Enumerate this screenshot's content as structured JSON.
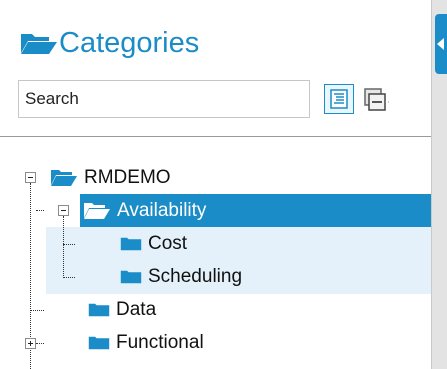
{
  "panel": {
    "title": "Categories",
    "title_icon": "folder-open-icon",
    "accent_color": "#1a8cc7"
  },
  "search": {
    "placeholder": "Search"
  },
  "toolbar": {
    "expand_all_icon": "expand-all-icon",
    "collapse_all_icon": "collapse-all-icon"
  },
  "tree": {
    "root": {
      "label": "RMDEMO",
      "expanded": true
    },
    "items": [
      {
        "label": "Availability",
        "expanded": true,
        "selected": true
      },
      {
        "label": "Cost"
      },
      {
        "label": "Scheduling"
      },
      {
        "label": "Data"
      },
      {
        "label": "Functional",
        "expanded": false
      }
    ]
  }
}
